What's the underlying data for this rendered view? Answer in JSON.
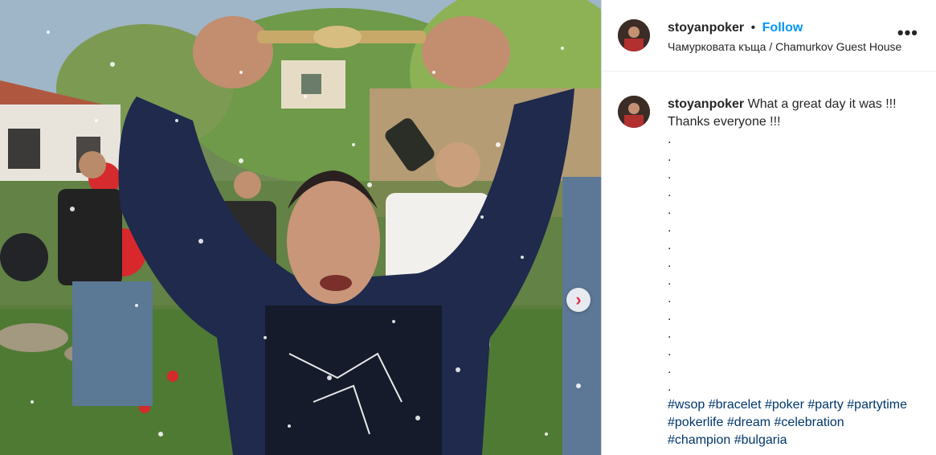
{
  "header": {
    "username": "stoyanpoker",
    "separator": "•",
    "follow_label": "Follow",
    "location": "Чамурковата къща / Chamurkov Guest House",
    "more_icon": "more-horizontal-icon",
    "more_label": "•••"
  },
  "photo": {
    "next_icon": "chevron-right-icon",
    "next_arrow": "›"
  },
  "caption": {
    "username": "stoyanpoker",
    "text": "What a great day it was !!! Thanks everyone !!!",
    "dots": [
      ".",
      ".",
      ".",
      ".",
      ".",
      ".",
      ".",
      ".",
      ".",
      ".",
      ".",
      ".",
      ".",
      ".",
      "."
    ],
    "hashtags": [
      "#wsop",
      "#bracelet",
      "#poker",
      "#party",
      "#partytime",
      "#pokerlife",
      "#dream",
      "#celebration",
      "#champion",
      "#bulgaria"
    ]
  },
  "colors": {
    "follow": "#0095f6",
    "hashtag": "#00376b",
    "text": "#262626",
    "border": "#dbdbdb"
  }
}
